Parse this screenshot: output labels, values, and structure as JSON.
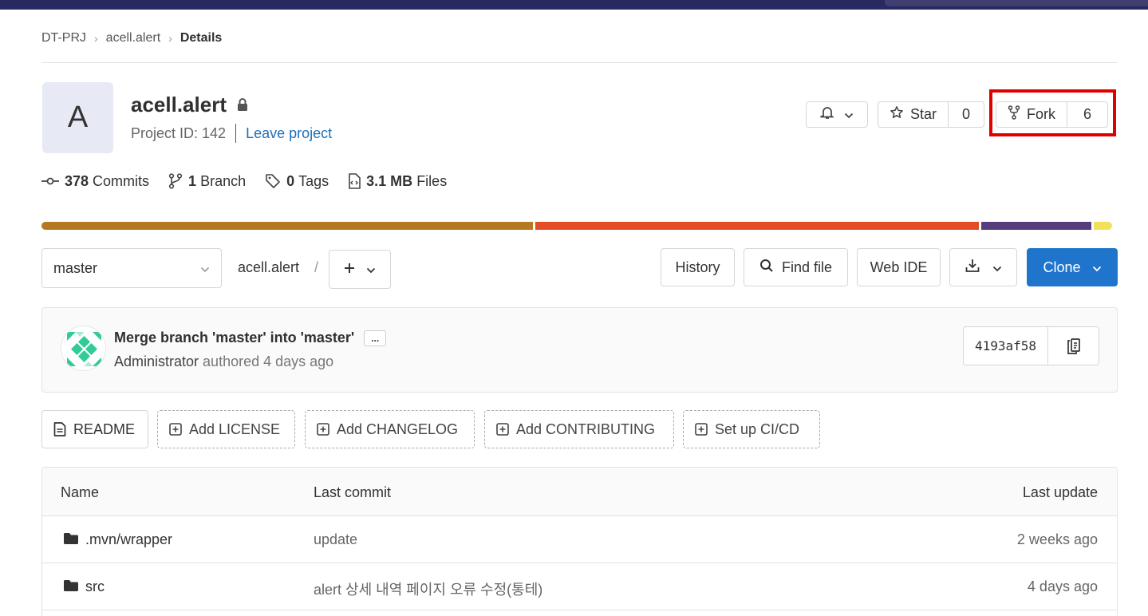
{
  "breadcrumb": {
    "items": [
      "DT-PRJ",
      "acell.alert"
    ],
    "current": "Details"
  },
  "project": {
    "avatar_letter": "A",
    "name": "acell.alert",
    "id_label": "Project ID: 142",
    "leave_label": "Leave project"
  },
  "actions": {
    "star_label": "Star",
    "star_count": "0",
    "fork_label": "Fork",
    "fork_count": "6"
  },
  "stats": {
    "commits_num": "378",
    "commits_label": "Commits",
    "branch_num": "1",
    "branch_label": "Branch",
    "tags_num": "0",
    "tags_label": "Tags",
    "files_num": "3.1 MB",
    "files_label": "Files"
  },
  "language_bar": [
    {
      "color": "#b5791f",
      "share": 0.46
    },
    {
      "color": "#e34c26",
      "share": 0.415
    },
    {
      "color": "#563d7c",
      "share": 0.103
    },
    {
      "color": "#f1e05a",
      "share": 0.017
    }
  ],
  "repo_toolbar": {
    "branch": "master",
    "path": "acell.alert",
    "path_sep": "/",
    "history": "History",
    "find_file": "Find file",
    "web_ide": "Web IDE",
    "clone": "Clone"
  },
  "last_commit": {
    "title": "Merge branch 'master' into 'master'",
    "ellipsis": "...",
    "author": "Administrator",
    "time_text": "authored 4 days ago",
    "sha": "4193af58"
  },
  "quick_buttons": {
    "readme": "README",
    "license": "Add LICENSE",
    "changelog": "Add CHANGELOG",
    "contributing": "Add CONTRIBUTING",
    "cicd": "Set up CI/CD"
  },
  "file_table": {
    "headers": {
      "name": "Name",
      "last_commit": "Last commit",
      "last_update": "Last update"
    },
    "rows": [
      {
        "name": ".mvn/wrapper",
        "commit": "update",
        "updated": "2 weeks ago"
      },
      {
        "name": "src",
        "commit": "alert 상세 내역 페이지 오류 수정(통테)",
        "updated": "4 days ago"
      }
    ]
  },
  "colors": {
    "topbar": "#292961",
    "primary_button": "#1f75cb",
    "link": "#1f6fb8",
    "highlight_box": "#e00000"
  }
}
